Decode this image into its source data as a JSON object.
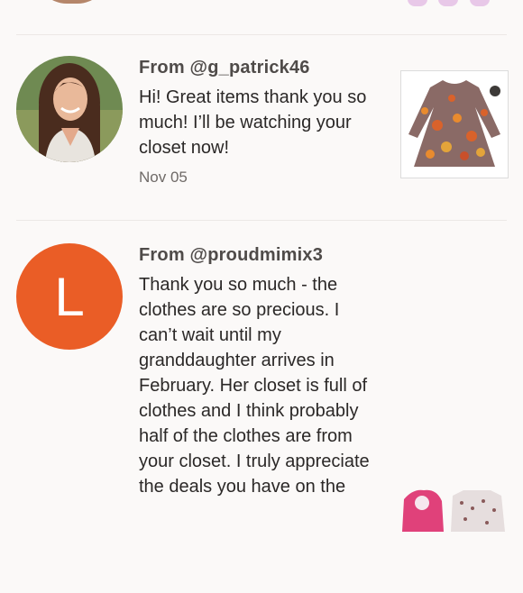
{
  "reviews": [
    {
      "from": "From @g_patrick46",
      "message": "Hi! Great items thank you so much! I’ll be watching your closet now!",
      "date": "Nov 05"
    },
    {
      "avatar_letter": "L",
      "from": "From @proudmimix3",
      "message": "Thank you so much - the clothes are so precious. I can’t wait until my granddaughter arrives in February. Her closet is full of clothes and I think probably half of the clothes are from your closet. I truly appreciate the deals you have on the"
    }
  ],
  "colors": {
    "letter_avatar_bg": "#ea5d26",
    "background": "#fbf9f8"
  }
}
